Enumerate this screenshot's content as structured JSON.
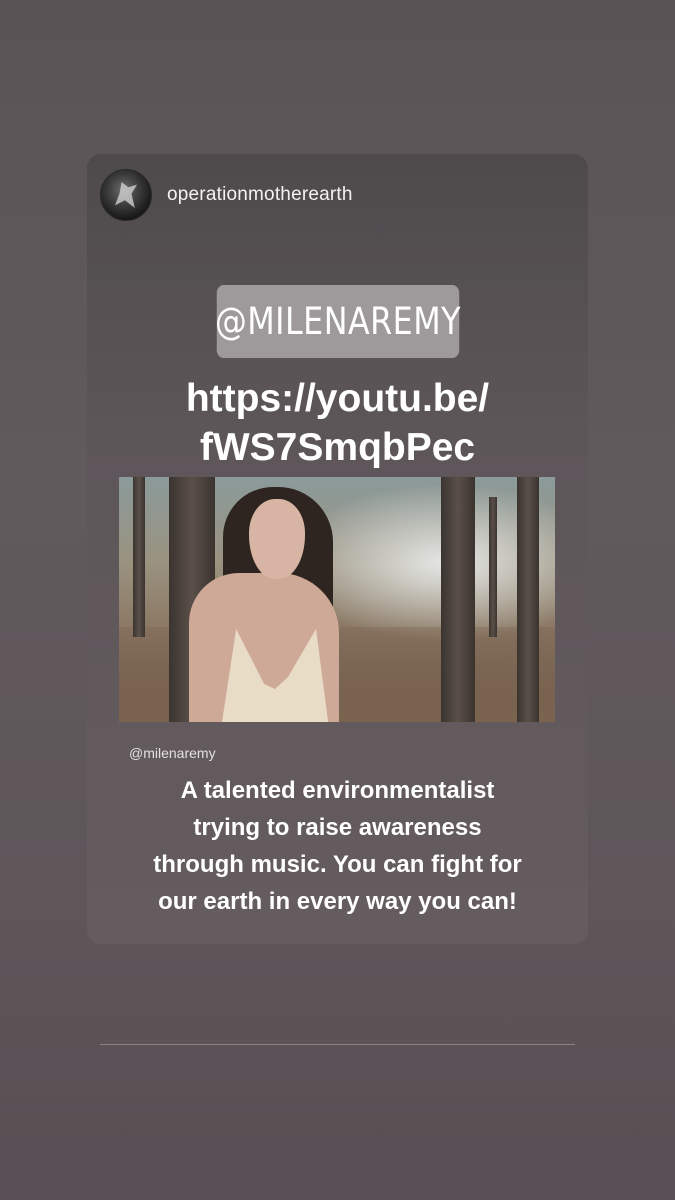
{
  "story": {
    "username": "operationmotherearth",
    "mention_sticker": "@MILENAREMY",
    "link_line1": "https://youtu.be/",
    "link_line2": "fWS7SmqbPec",
    "photo_caption_handle": "@milenaremy",
    "caption_line1": "A talented environmentalist",
    "caption_line2": "trying to raise awareness",
    "caption_line3": "through music. You can fight for",
    "caption_line4": "our earth in every way you can!"
  },
  "colors": {
    "background": "#5e5659",
    "sticker": "#9e9a9c",
    "text": "#ffffff"
  },
  "icons": {
    "avatar": "bird-logo-avatar"
  }
}
